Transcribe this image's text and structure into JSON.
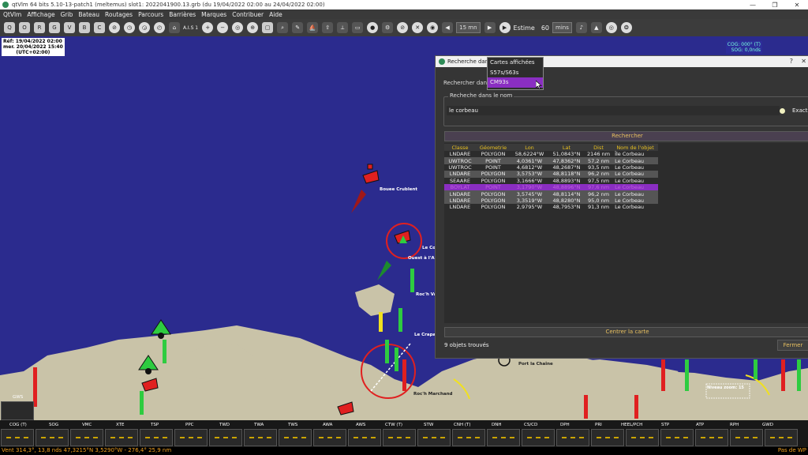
{
  "window": {
    "title": "qtVlm 64 bits 5.10-13-patch1 (meltemus) slot1: 2022041900.13.grb (du 19/04/2022 02:00 au 24/04/2022 02:00)",
    "buttons": [
      "—",
      "❐",
      "✕"
    ]
  },
  "menu": [
    "QtVlm",
    "Affichage",
    "Grib",
    "Bateau",
    "Routages",
    "Parcours",
    "Barrières",
    "Marques",
    "Contribuer",
    "Aide"
  ],
  "toolbar": {
    "time_step": "15 mn",
    "mode_label": "Estime",
    "duration_value": "60",
    "duration_unit": "mins",
    "ais_label": "A.I.S 1"
  },
  "map": {
    "ref_time_lines": [
      "Réf: 19/04/2022 02:00",
      "mer. 20/04/2022 15:40",
      "(UTC+02:00)"
    ],
    "cog_line": "COG: 000° (T)",
    "sog_line": "SOG: 0,0nds",
    "labels": [
      {
        "id": "bouee-crublent",
        "text": "Bouee Crublent",
        "dark": false
      },
      {
        "id": "le-co",
        "text": "Le Co",
        "dark": false
      },
      {
        "id": "a-larc",
        "text": "Ouest à l'Arc",
        "dark": false
      },
      {
        "id": "roc-h-vas",
        "text": "Roc'h Vas",
        "dark": false
      },
      {
        "id": "le-crapaud",
        "text": "Le Crapaud",
        "dark": false
      },
      {
        "id": "port-chaine",
        "text": "Port la Chaîne",
        "dark": false
      },
      {
        "id": "roch-marchand",
        "text": "Roc'h Marchand",
        "dark": false
      },
      {
        "id": "niveau-zoom",
        "text": "Niveau zoom: 15",
        "dark": false
      }
    ]
  },
  "dialog": {
    "title": "Recherche dans le",
    "help": "?",
    "close": "✕",
    "search_in_label": "Rechercher dans",
    "dropdown_options": [
      "Cartes affichées",
      "S57s/S63s",
      "CM93s"
    ],
    "dropdown_selected_index": 2,
    "group_title": "Recheche dans le nom",
    "name_value": "le corbeau",
    "exact_label": "Exact",
    "search_button": "Rechercher",
    "columns": [
      "Classe",
      "Géometrie",
      "Lon",
      "Lat",
      "Dist",
      "Nom de l'objet"
    ],
    "rows": [
      [
        "LNDARE",
        "POLYGON",
        "58,6224°W",
        "51,0843°N",
        "2146 nm",
        "Île Corbeau"
      ],
      [
        "UWTROC",
        "POINT",
        "4,0361°W",
        "47,8362°N",
        "57,2 nm",
        "Le Corbeau"
      ],
      [
        "UWTROC",
        "POINT",
        "4,6812°W",
        "48,2687°N",
        "93,5 nm",
        "Le Corbeau"
      ],
      [
        "LNDARE",
        "POLYGON",
        "3,5753°W",
        "48,8118°N",
        "96,2 nm",
        "Le Corbeau"
      ],
      [
        "SEAARE",
        "POLYGON",
        "3,1666°W",
        "48,8893°N",
        "97,5 nm",
        "Le Corbeau"
      ],
      [
        "BOYLAT",
        "POINT",
        "3,1790°W",
        "48,8896°N",
        "97,6 nm",
        "Le Corbeau"
      ],
      [
        "LNDARE",
        "POLYGON",
        "3,5745°W",
        "48,8114°N",
        "96,2 nm",
        "Le Corbeau"
      ],
      [
        "LNDARE",
        "POLYGON",
        "3,3519°W",
        "48,8280°N",
        "95,0 nm",
        "Le Corbeau"
      ],
      [
        "LNDARE",
        "POLYGON",
        "2,9795°W",
        "48,7953°N",
        "91,3 nm",
        "Le Corbeau"
      ]
    ],
    "selected_row_index": 5,
    "center_button": "Centrer la carte",
    "found_text": "9 objets trouvés",
    "close_button": "Fermer"
  },
  "instruments": {
    "gws_label": "GWS",
    "labels": [
      "COG (T)",
      "SOG",
      "VMC",
      "XTE",
      "TSP",
      "PPC",
      "TWD",
      "TWA",
      "TWS",
      "AWA",
      "AWS",
      "CTW (T)",
      "STW",
      "CNH (T)",
      "DNH",
      "CS/CD",
      "DPH",
      "PRI",
      "HEEL/PCH",
      "STP",
      "ATP",
      "RPH",
      "GWD"
    ]
  },
  "status": {
    "left": "Vent 314,3°, 13,8 nds 47,3215°N 3,5290°W - 276,4° 25,9 nm",
    "right": "Pas de WP"
  },
  "colors": {
    "sea": "#2b2b8e",
    "land": "#c9c3a8",
    "accent": "#8a2ec2",
    "header_text": "#e8c020"
  }
}
